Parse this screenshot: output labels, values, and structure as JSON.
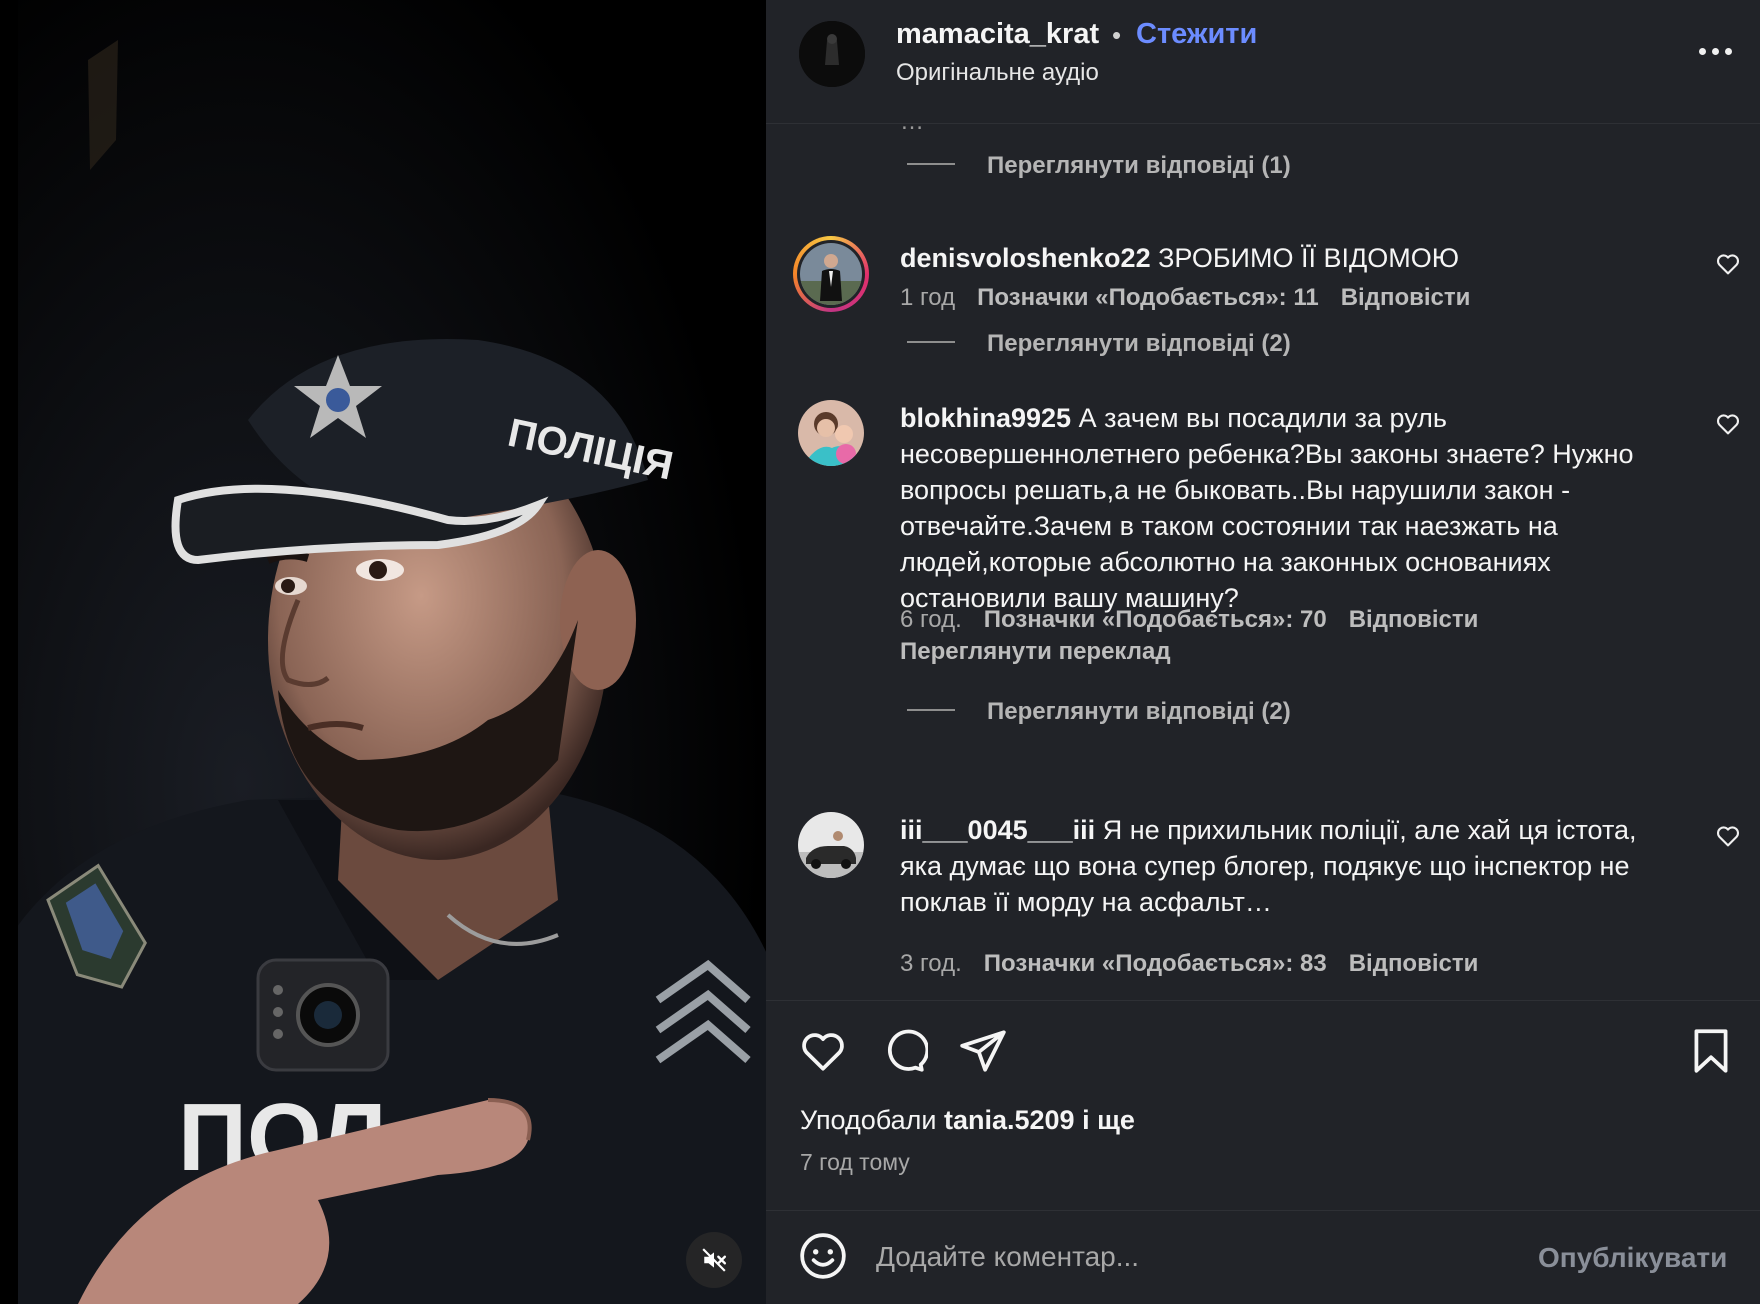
{
  "post": {
    "author": "mamacita_krat",
    "separator": "•",
    "follow_label": "Стежити",
    "audio": "Оригінальне аудіо",
    "more_icon": "more-horizontal-icon"
  },
  "video": {
    "cap_text": "ПОЛІЦІЯ",
    "vest_text": "ПОЛ",
    "mute_icon": "speaker-muted-icon"
  },
  "comments": {
    "clipped_above": "…",
    "view_replies_1": "Переглянути відповіді (1)",
    "items": [
      {
        "username": "denisvoloshenko22",
        "text": "ЗРОБИМО ЇЇ ВІДОМОЮ",
        "time": "1 год",
        "likes": "Позначки «Подобається»: 11",
        "reply": "Відповісти",
        "replies": "Переглянути відповіді (2)"
      },
      {
        "username": "blokhina9925",
        "text": "А зачем вы посадили за руль несовершеннолетнего ребенка?Вы законы знаете? Нужно вопросы решать,а не быковать..Вы нарушили закон - отвечайте.Зачем в таком состоянии так наезжать на людей,которые абсолютно на законных основаниях остановили вашу машину?",
        "time": "6 год.",
        "likes": "Позначки «Подобається»: 70",
        "reply": "Відповісти",
        "translate": "Переглянути переклад",
        "replies": "Переглянути відповіді (2)"
      },
      {
        "username": "iii___0045___iii",
        "text": "Я не прихильник поліції, але хай ця істота, яка думає що вона супер блогер, подякує що інспектор не поклав її морду на асфальт…",
        "time": "3 год.",
        "likes": "Позначки «Подобається»: 83",
        "reply": "Відповісти"
      }
    ]
  },
  "actions": {
    "like_icon": "heart-icon",
    "comment_icon": "comment-bubble-icon",
    "share_icon": "paper-plane-icon",
    "save_icon": "bookmark-icon",
    "liked_by_prefix": "Уподобали",
    "liked_by_user": "tania.5209",
    "liked_by_suffix": "і ще",
    "time_ago": "7 год тому"
  },
  "composer": {
    "emoji_icon": "smiley-icon",
    "placeholder": "Додайте коментар...",
    "publish_label": "Опублікувати"
  },
  "colors": {
    "panel_bg": "#212328",
    "follow_blue": "#6c8cff",
    "muted_text": "#a8a8a8"
  }
}
